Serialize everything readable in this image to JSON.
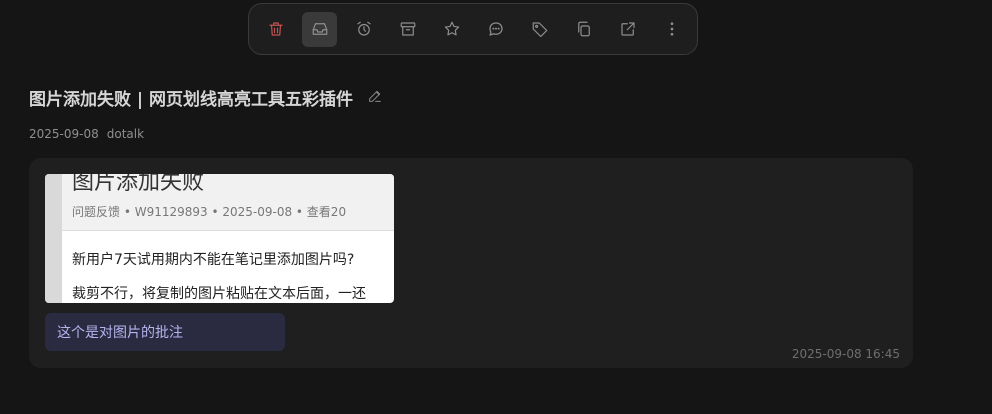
{
  "toolbar": {
    "buttons": [
      {
        "name": "delete-icon"
      },
      {
        "name": "inbox-icon"
      },
      {
        "name": "alarm-icon"
      },
      {
        "name": "archive-icon"
      },
      {
        "name": "star-icon"
      },
      {
        "name": "comment-icon"
      },
      {
        "name": "tag-icon"
      },
      {
        "name": "copy-icon"
      },
      {
        "name": "open-external-icon"
      },
      {
        "name": "more-vertical-icon"
      }
    ],
    "danger_color": "#c25252",
    "active_button": "inbox-icon"
  },
  "note": {
    "title": "图片添加失败 | 网页划线高亮工具五彩插件",
    "date": "2025-09-08",
    "source": "dotalk",
    "screenshot": {
      "title": "图片添加失败",
      "subtitle": "问题反馈 • W91129893 • 2025-09-08 • 查看20",
      "line1": "新用户7天试用期内不能在笔记里添加图片吗?",
      "line2": "裁剪不行，将复制的图片粘贴在文本后面，一还"
    },
    "annotation": "这个是对图片的批注",
    "timestamp": "2025-09-08 16:45"
  }
}
